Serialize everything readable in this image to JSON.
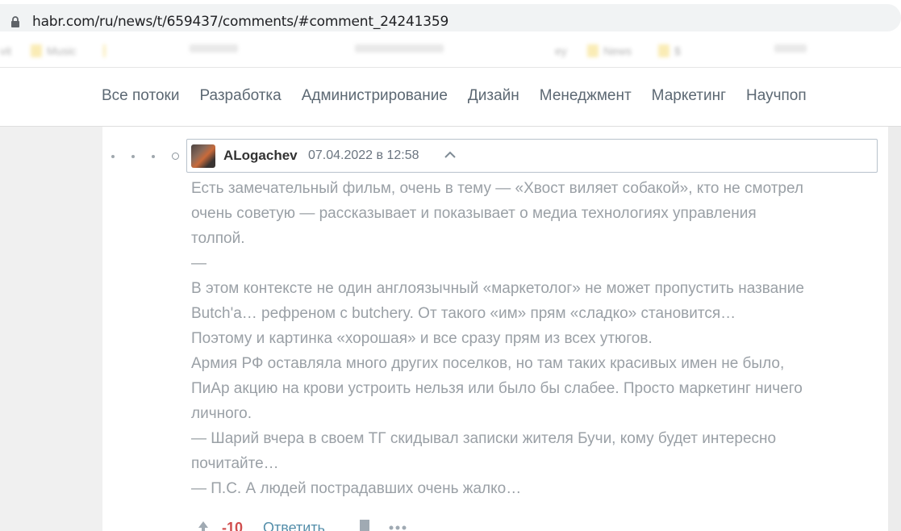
{
  "browser": {
    "url": "habr.com/ru/news/t/659437/comments/#comment_24241359",
    "bookmarks": [
      "vit",
      "Music",
      "",
      "",
      "",
      "",
      "ey",
      "News",
      "$"
    ]
  },
  "nav": {
    "items": [
      "Все потоки",
      "Разработка",
      "Администрирование",
      "Дизайн",
      "Менеджмент",
      "Маркетинг",
      "Научпоп"
    ]
  },
  "comment": {
    "author": "ALogachev",
    "date": "07.04.2022 в 12:58",
    "lines": [
      "Есть замечательный фильм, очень в тему — «Хвост виляет собакой», кто не смотрел",
      "очень советую — рассказывает и показывает о медиа технологиях управления",
      "толпой.",
      "—",
      "В этом контексте не один англоязычный «маркетолог» не может пропустить название",
      "Butch'a… рефреном с butchery. От такого «им» прям «сладко» становится…",
      "Поэтому и картинка «хорошая» и все сразу прям из всех утюгов.",
      "Армия РФ оставляла много других поселков, но там таких красивых имен не было,",
      "ПиАр акцию на крови устроить нельзя или было бы слабее. Просто маркетинг ничего",
      "личного.",
      "— Шарий вчера в своем ТГ скидывал записки жителя Бучи, кому будет интересно",
      "почитайте…",
      "— П.С. А людей пострадавших очень жалко…"
    ],
    "score": "-10",
    "reply_label": "Ответить"
  },
  "icons": {
    "lock": "lock-icon",
    "collapse": "chevron-up-icon",
    "vote": "vote-up-icon",
    "bookmark": "bookmark-icon",
    "more": "more-dots-icon"
  },
  "colors": {
    "score_negative": "#d04e4e",
    "link": "#548eaa"
  }
}
